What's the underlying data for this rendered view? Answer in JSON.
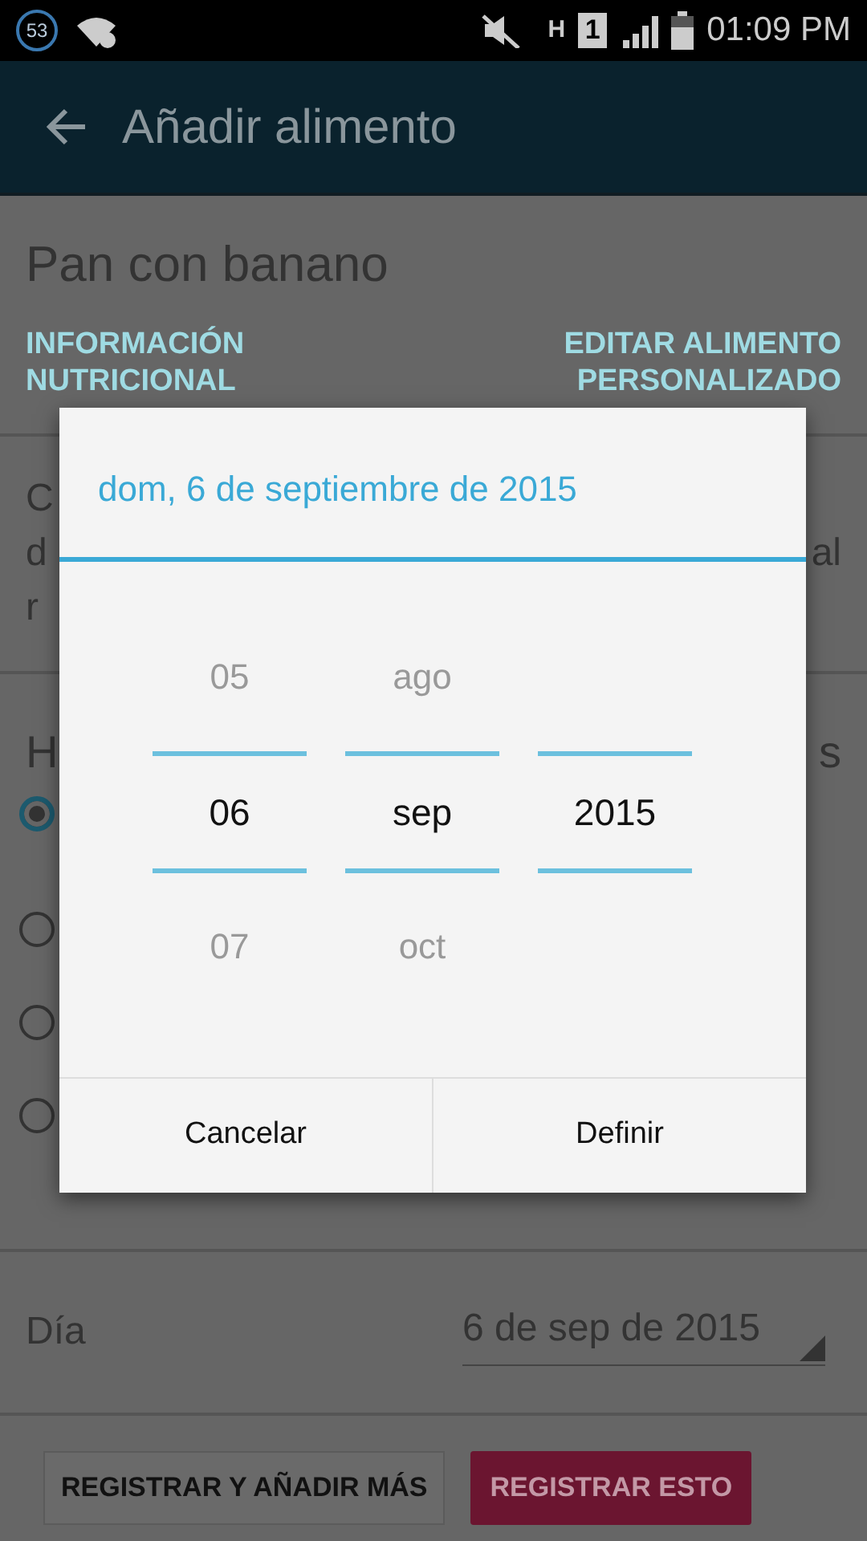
{
  "status_bar": {
    "notification_count": "53",
    "network": "H",
    "sim": "1",
    "time": "01:09 PM"
  },
  "app_bar": {
    "title": "Añadir alimento"
  },
  "food": {
    "name": "Pan con banano",
    "links": [
      "INFORMACIÓN NUTRICIONAL",
      "EDITAR ALIMENTO PERSONALIZADO"
    ]
  },
  "description_lines": [
    {
      "left": "C"
    },
    {
      "left": "d",
      "right": "al"
    },
    {
      "left": "r"
    }
  ],
  "section": {
    "heading_left": "H",
    "heading_right": "s",
    "radios": [
      {
        "selected": true
      },
      {
        "selected": false
      },
      {
        "selected": false
      },
      {
        "selected": false
      }
    ]
  },
  "day": {
    "label": "Día",
    "value": "6 de sep de 2015"
  },
  "buttons": [
    {
      "label": "REGISTRAR Y AÑADIR MÁS",
      "kind": "secondary"
    },
    {
      "label": "REGISTRAR ESTO",
      "kind": "primary"
    }
  ],
  "dialog": {
    "title": "dom, 6 de septiembre de 2015",
    "columns": [
      {
        "previous": "05",
        "current": "06",
        "next": "07"
      },
      {
        "previous": "ago",
        "current": "sep",
        "next": "oct"
      },
      {
        "current": "2015"
      }
    ],
    "buttons": [
      "Cancelar",
      "Definir"
    ]
  }
}
